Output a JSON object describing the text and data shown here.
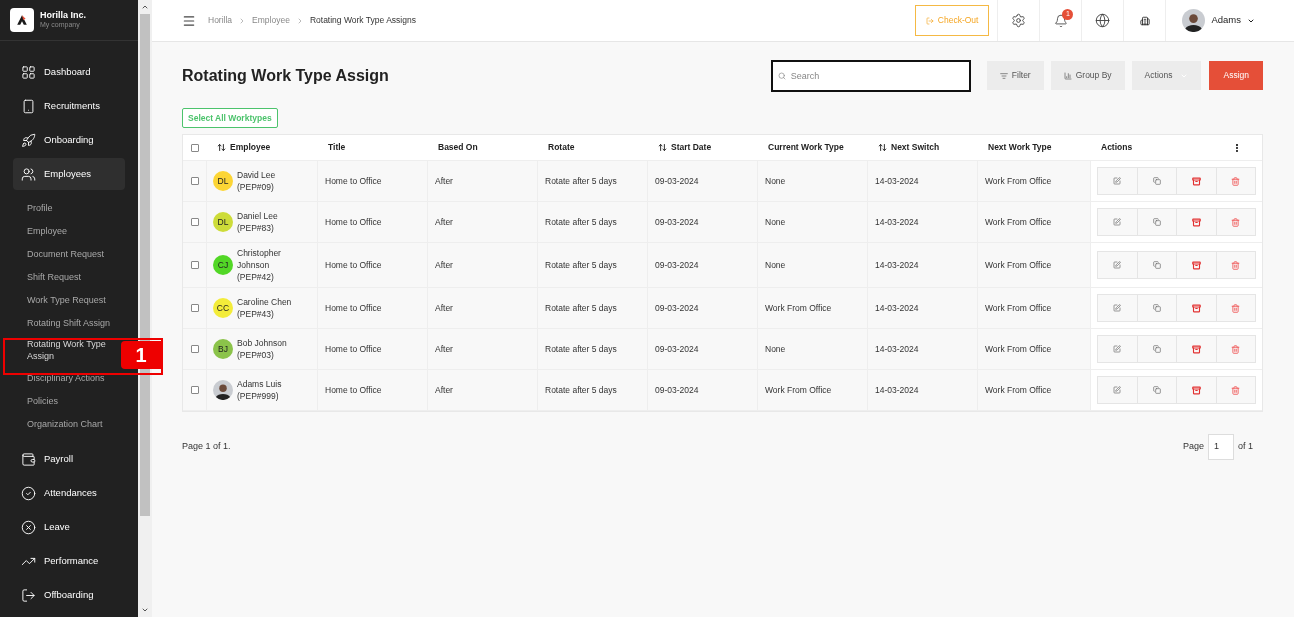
{
  "company": {
    "name": "Horilla Inc.",
    "subtitle": "My company"
  },
  "sidebar": {
    "items": [
      {
        "label": "Dashboard",
        "selected": false
      },
      {
        "label": "Recruitments",
        "selected": false
      },
      {
        "label": "Onboarding",
        "selected": false
      },
      {
        "label": "Employees",
        "selected": true,
        "children": [
          {
            "label": "Profile",
            "selected": false
          },
          {
            "label": "Employee",
            "selected": false
          },
          {
            "label": "Document Request",
            "selected": false
          },
          {
            "label": "Shift Request",
            "selected": false
          },
          {
            "label": "Work Type Request",
            "selected": false
          },
          {
            "label": "Rotating Shift Assign",
            "selected": false
          },
          {
            "label": "Rotating Work Type Assign",
            "selected": true
          },
          {
            "label": "Disciplinary Actions",
            "selected": false
          },
          {
            "label": "Policies",
            "selected": false
          },
          {
            "label": "Organization Chart",
            "selected": false
          }
        ]
      },
      {
        "label": "Payroll",
        "selected": false
      },
      {
        "label": "Attendances",
        "selected": false
      },
      {
        "label": "Leave",
        "selected": false
      },
      {
        "label": "Performance",
        "selected": false
      },
      {
        "label": "Offboarding",
        "selected": false
      }
    ]
  },
  "annotation": {
    "label": "1"
  },
  "breadcrumb": [
    "Horilla",
    "Employee",
    "Rotating Work Type Assigns"
  ],
  "header": {
    "checkout": "Check-Out",
    "notifications": "1",
    "user": "Adams"
  },
  "page_title": "Rotating Work Type Assign",
  "search": {
    "placeholder": "Search"
  },
  "toolbar": {
    "filter": "Filter",
    "group_by": "Group By",
    "actions": "Actions",
    "assign": "Assign"
  },
  "select_all": "Select All Worktypes",
  "table": {
    "all_checked": false,
    "columns": [
      {
        "label": "Employee",
        "sortable": true
      },
      {
        "label": "Title",
        "sortable": false
      },
      {
        "label": "Based On",
        "sortable": false
      },
      {
        "label": "Rotate",
        "sortable": false
      },
      {
        "label": "Start Date",
        "sortable": true
      },
      {
        "label": "Current Work Type",
        "sortable": false
      },
      {
        "label": "Next Switch",
        "sortable": true
      },
      {
        "label": "Next Work Type",
        "sortable": false
      },
      {
        "label": "Actions",
        "sortable": false
      }
    ],
    "rows": [
      {
        "initials": "DL",
        "color": "#fcd535",
        "name": "David Lee",
        "id": "(PEP#09)",
        "title": "Home to Office",
        "based_on": "After",
        "rotate": "Rotate after 5 days",
        "start": "09-03-2024",
        "current": "None",
        "next_switch": "14-03-2024",
        "next": "Work From Office",
        "checked": false
      },
      {
        "initials": "DL",
        "color": "#cddc39",
        "name": "Daniel Lee",
        "id": "(PEP#83)",
        "title": "Home to Office",
        "based_on": "After",
        "rotate": "Rotate after 5 days",
        "start": "09-03-2024",
        "current": "None",
        "next_switch": "14-03-2024",
        "next": "Work From Office",
        "checked": false
      },
      {
        "initials": "CJ",
        "color": "#52d726",
        "name": "Christopher Johnson",
        "id": "(PEP#42)",
        "title": "Home to Office",
        "based_on": "After",
        "rotate": "Rotate after 5 days",
        "start": "09-03-2024",
        "current": "None",
        "next_switch": "14-03-2024",
        "next": "Work From Office",
        "checked": false
      },
      {
        "initials": "CC",
        "color": "#f3ec3a",
        "name": "Caroline Chen",
        "id": "(PEP#43)",
        "title": "Home to Office",
        "based_on": "After",
        "rotate": "Rotate after 5 days",
        "start": "09-03-2024",
        "current": "Work From Office",
        "next_switch": "14-03-2024",
        "next": "Work From Office",
        "checked": false
      },
      {
        "initials": "BJ",
        "color": "#8bc34a",
        "name": "Bob Johnson",
        "id": "(PEP#03)",
        "title": "Home to Office",
        "based_on": "After",
        "rotate": "Rotate after 5 days",
        "start": "09-03-2024",
        "current": "None",
        "next_switch": "14-03-2024",
        "next": "Work From Office",
        "checked": false
      },
      {
        "kind": "photo",
        "name": "Adams Luis",
        "id": "(PEP#999)",
        "title": "Home to Office",
        "based_on": "After",
        "rotate": "Rotate after 5 days",
        "start": "09-03-2024",
        "current": "Work From Office",
        "next_switch": "14-03-2024",
        "next": "Work From Office",
        "checked": false
      }
    ]
  },
  "pagination": {
    "summary": "Page 1 of 1.",
    "page_label": "Page",
    "page": "1",
    "of": "of 1"
  }
}
